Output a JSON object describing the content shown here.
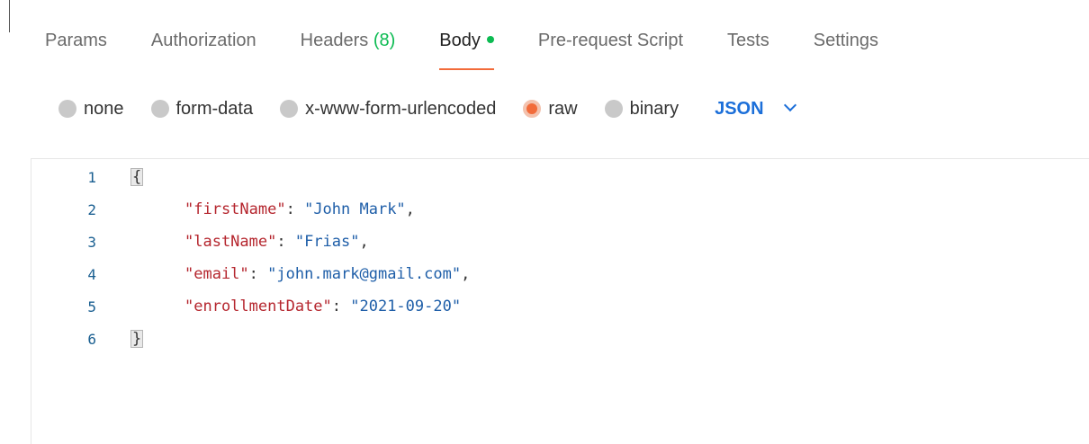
{
  "tabs": [
    {
      "label": "Params"
    },
    {
      "label": "Authorization"
    },
    {
      "label": "Headers",
      "count": "(8)"
    },
    {
      "label": "Body"
    },
    {
      "label": "Pre-request Script"
    },
    {
      "label": "Tests"
    },
    {
      "label": "Settings"
    }
  ],
  "active_tab": "Body",
  "accent_color": "#f26b3a",
  "indicator_color": "#0cbb52",
  "body_modes": [
    {
      "label": "none"
    },
    {
      "label": "form-data"
    },
    {
      "label": "x-www-form-urlencoded"
    },
    {
      "label": "raw"
    },
    {
      "label": "binary"
    }
  ],
  "selected_mode": "raw",
  "format": "JSON",
  "editor": {
    "lines": [
      {
        "num": "1",
        "open": "{"
      },
      {
        "num": "2",
        "key": "\"firstName\"",
        "value": "\"John Mark\"",
        "trail": ","
      },
      {
        "num": "3",
        "key": "\"lastName\"",
        "value": "\"Frias\"",
        "trail": ","
      },
      {
        "num": "4",
        "key": "\"email\"",
        "value": "\"john.mark@gmail.com\"",
        "trail": ","
      },
      {
        "num": "5",
        "key": "\"enrollmentDate\"",
        "value": "\"2021-09-20\"",
        "trail": ""
      },
      {
        "num": "6",
        "close": "}"
      }
    ]
  }
}
